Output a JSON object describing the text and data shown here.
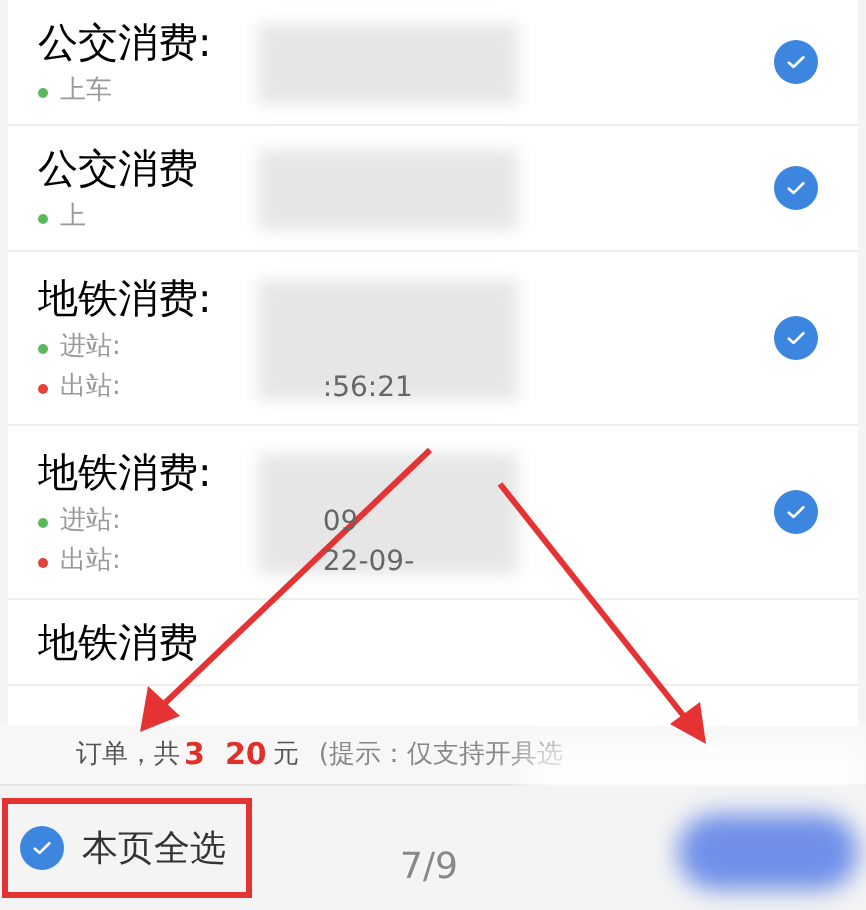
{
  "items": [
    {
      "title": "公交消费:",
      "checked": true,
      "lines": [
        {
          "color": "#5cb85c",
          "label": "上车"
        }
      ]
    },
    {
      "title": "公交消费",
      "checked": true,
      "lines": [
        {
          "color": "#5cb85c",
          "label": "上"
        }
      ]
    },
    {
      "title": "地铁消费:",
      "checked": true,
      "lines": [
        {
          "color": "#5cb85c",
          "label": "进站:"
        },
        {
          "color": "#e0443a",
          "label": "出站:",
          "value": ":56:21"
        }
      ]
    },
    {
      "title": "地铁消费:",
      "checked": true,
      "lines": [
        {
          "color": "#5cb85c",
          "label": "进站:",
          "value": "09"
        },
        {
          "color": "#e0443a",
          "label": "出站:",
          "value": "22-09-"
        }
      ]
    },
    {
      "title": "地铁消费"
    }
  ],
  "summary": {
    "prefix": "订单，共",
    "amount_start": "3",
    "amount_end": "20",
    "unit": "元",
    "hint": "(提示：仅支持开具选"
  },
  "footer": {
    "select_all": {
      "label": "本页全选",
      "checked": true
    },
    "page": "7/9"
  }
}
